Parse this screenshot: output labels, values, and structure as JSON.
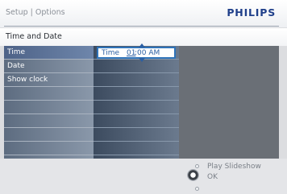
{
  "header": {
    "breadcrumb": "Setup | Options",
    "brand": "PHILIPS"
  },
  "section": {
    "title": "Time and Date"
  },
  "menu": {
    "items": [
      {
        "label": "Time",
        "selected": true
      },
      {
        "label": "Date",
        "selected": false
      },
      {
        "label": "Show clock",
        "selected": false
      }
    ]
  },
  "editor": {
    "label": "Time",
    "hour": "01",
    "rest": ":00 AM"
  },
  "footer": {
    "play_label": "Play Slideshow",
    "ok_label": "OK"
  },
  "colors": {
    "brand": "#1f3f8a",
    "selection": "#4d6287",
    "field_border": "#2f73b9"
  }
}
